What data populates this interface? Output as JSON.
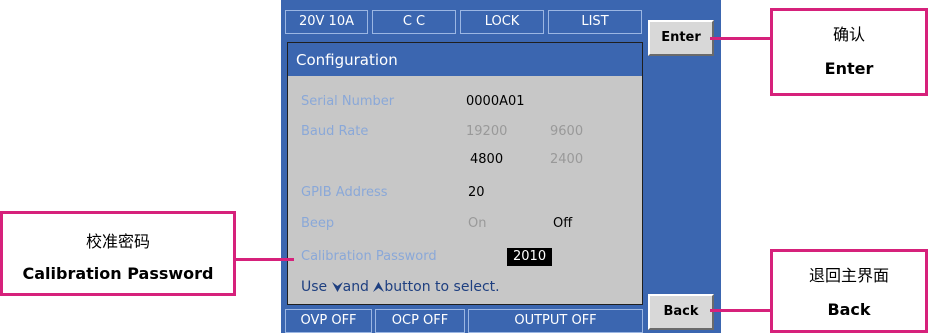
{
  "status_bar": {
    "range": "20V 10A",
    "mode": "C C",
    "lock": "LOCK",
    "list": "LIST"
  },
  "config": {
    "title": "Configuration",
    "serial_label": "Serial Number",
    "serial_value": "0000A01",
    "baud_label": "Baud Rate",
    "baud_options": [
      "19200",
      "9600",
      "4800",
      "2400"
    ],
    "baud_selected": "4800",
    "gpib_label": "GPIB Address",
    "gpib_value": "20",
    "beep_label": "Beep",
    "beep_on": "On",
    "beep_off": "Off",
    "beep_selected": "Off",
    "cal_label": "Calibration Password",
    "cal_value": "2010",
    "hint_use": "Use",
    "hint_and": "and",
    "hint_rest": "button to select."
  },
  "softkeys": {
    "enter": "Enter",
    "back": "Back"
  },
  "bottom_bar": {
    "ovp": "OVP OFF",
    "ocp": "OCP OFF",
    "output": "OUTPUT OFF"
  },
  "callouts": {
    "enter_zh": "确认",
    "enter_en": "Enter",
    "cal_zh": "校准密码",
    "cal_en": "Calibration Password",
    "back_zh": "退回主界面",
    "back_en": "Back"
  },
  "colors": {
    "screen_blue": "#3b66b0",
    "callout_magenta": "#d6217b",
    "panel_gray": "#c7c7c7"
  }
}
